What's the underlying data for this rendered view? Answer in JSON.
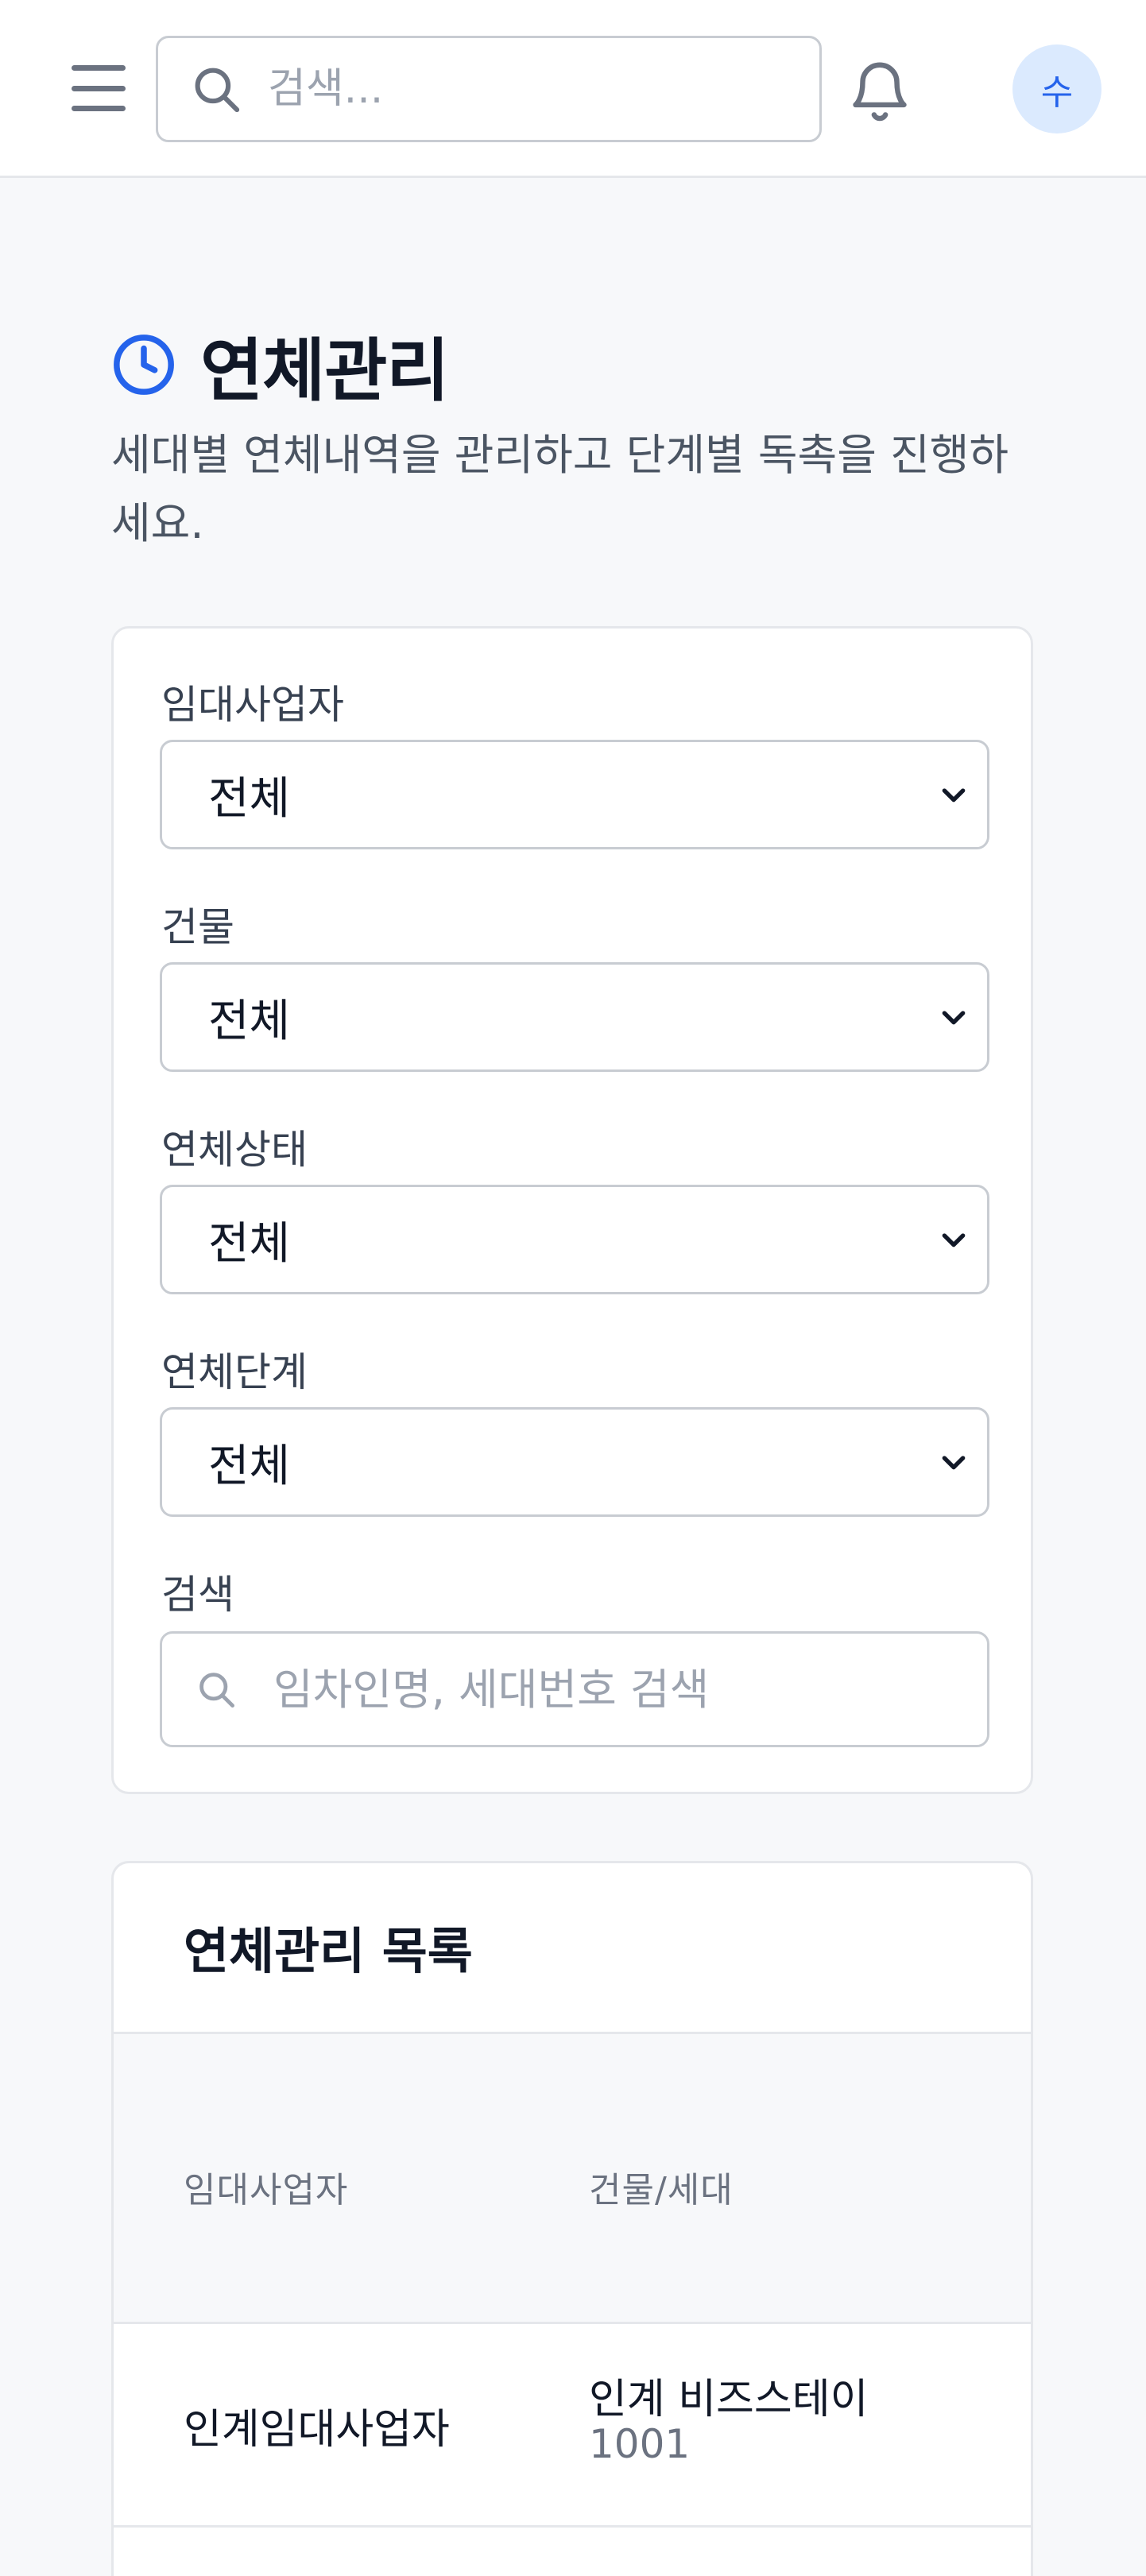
{
  "topbar": {
    "search_placeholder": "검색...",
    "avatar_initial": "수"
  },
  "header": {
    "title": "연체관리",
    "description": "세대별 연체내역을 관리하고 단계별 독촉을 진행하세요."
  },
  "filters": {
    "lessor": {
      "label": "임대사업자",
      "value": "전체"
    },
    "building": {
      "label": "건물",
      "value": "전체"
    },
    "status": {
      "label": "연체상태",
      "value": "전체"
    },
    "stage": {
      "label": "연체단계",
      "value": "전체"
    },
    "search": {
      "label": "검색",
      "placeholder": "임차인명, 세대번호 검색"
    }
  },
  "list": {
    "title": "연체관리 목록",
    "columns": [
      "임대사업자",
      "건물/세대"
    ],
    "rows": [
      {
        "lessor": "인계임대사업자",
        "building": "인계 비즈스테이",
        "unit": "1001"
      }
    ]
  },
  "colors": {
    "accent": "#2563eb",
    "avatar_bg": "#dbeafe",
    "page_bg": "#f7f8fa",
    "border": "#e5e7eb"
  },
  "icons": [
    "menu-icon",
    "search-icon",
    "bell-icon",
    "clock-icon",
    "chevron-down-icon"
  ]
}
